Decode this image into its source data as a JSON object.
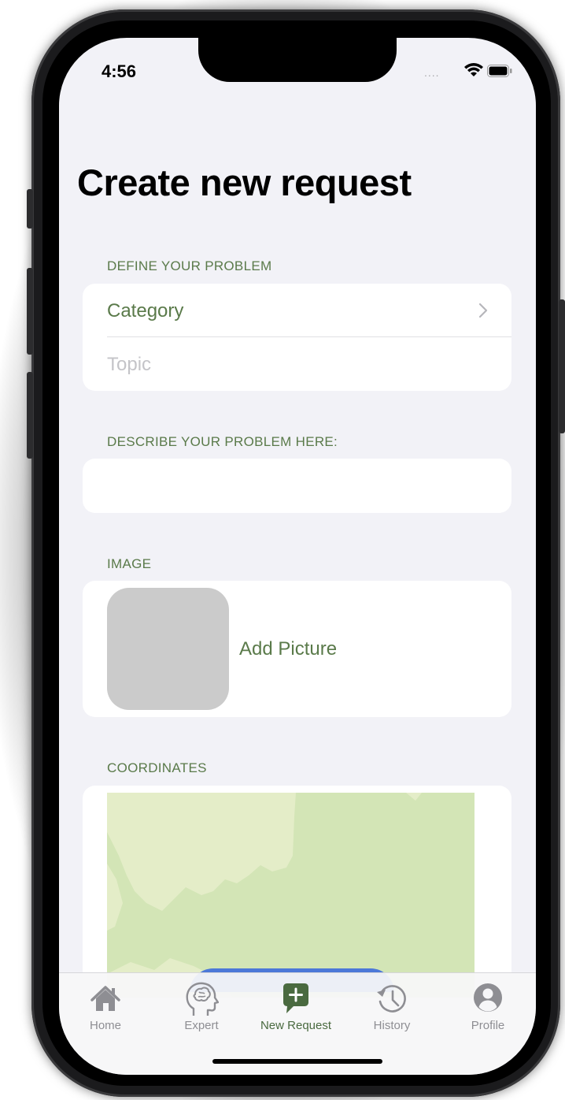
{
  "status": {
    "time": "4:56",
    "dots": "....",
    "wifi_icon": "wifi-icon",
    "battery_icon": "battery-icon"
  },
  "page": {
    "title": "Create new request"
  },
  "sections": {
    "define": {
      "label": "DEFINE YOUR PROBLEM",
      "category": "Category",
      "topic_placeholder": "Topic"
    },
    "describe": {
      "label": "DESCRIBE YOUR PROBLEM HERE:"
    },
    "image": {
      "label": "IMAGE",
      "add_picture": "Add Picture"
    },
    "coordinates": {
      "label": "COORDINATES"
    }
  },
  "tabs": [
    {
      "label": "Home",
      "icon": "home-icon",
      "active": false
    },
    {
      "label": "Expert",
      "icon": "brain-head-icon",
      "active": false
    },
    {
      "label": "New Request",
      "icon": "plus-message-icon",
      "active": true
    },
    {
      "label": "History",
      "icon": "history-icon",
      "active": false
    },
    {
      "label": "Profile",
      "icon": "person-circle-icon",
      "active": false
    }
  ],
  "colors": {
    "accent": "#5a7a4a",
    "background": "#f2f2f7",
    "map": "#d3e5b6",
    "map_light": "#e6eec9"
  }
}
